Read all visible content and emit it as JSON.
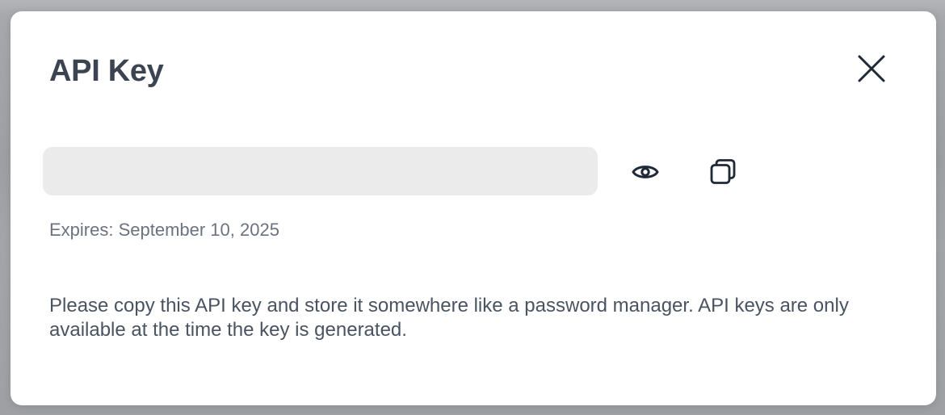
{
  "modal": {
    "title": "API Key",
    "close_icon": "close-icon",
    "key_field": {
      "value": "",
      "placeholder": ""
    },
    "reveal_icon": "eye-icon",
    "copy_icon": "copy-icon",
    "expires_text": "Expires: September 10, 2025",
    "notice_text": "Please copy this API key and store it somewhere like a password manager. API keys are only available at the time the key is generated."
  },
  "colors": {
    "backdrop": "#9ea1a6",
    "modal_background": "#ffffff",
    "input_background": "#ebebeb",
    "title_text": "#3b4450",
    "muted_text": "#6b7280",
    "body_text": "#4a5361",
    "icon": "#1f2937"
  }
}
